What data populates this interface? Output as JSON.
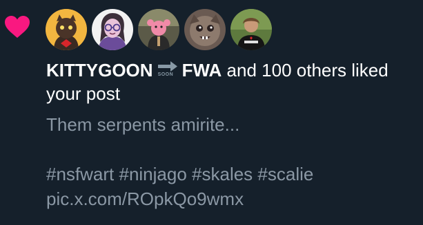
{
  "notification": {
    "type_icon": "heart-icon",
    "accent_color": "#f91880",
    "avatars": [
      {
        "icon": "avatar-cartoon-cat-character"
      },
      {
        "icon": "avatar-cartoon-glasses-character"
      },
      {
        "icon": "avatar-person-pink-mask"
      },
      {
        "icon": "avatar-drawn-creature"
      },
      {
        "icon": "avatar-person-cowboy-shirt"
      }
    ],
    "first_user": "KITTYGOON",
    "soon_label": "SOON",
    "second_user": "FWA",
    "summary_suffix": " and 100 others liked your post",
    "post_lines": [
      "Them serpents amirite...",
      "",
      "#nsfwart #ninjago #skales #scalie",
      "pic.x.com/ROpkQo9wmx"
    ]
  }
}
